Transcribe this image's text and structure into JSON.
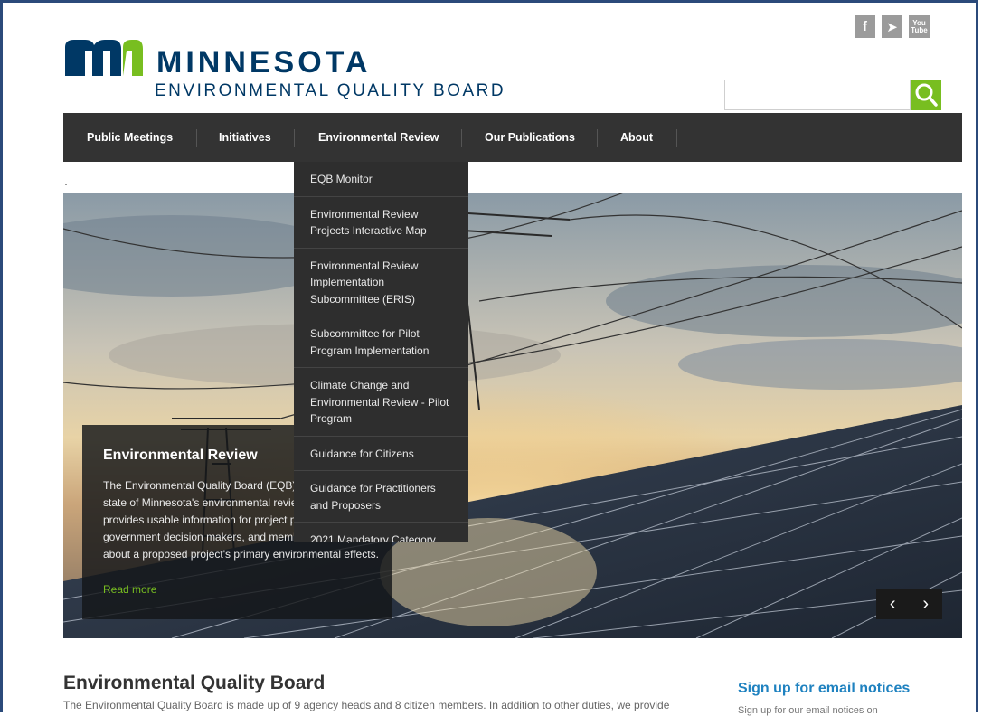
{
  "header": {
    "logo_name": "MINNESOTA",
    "logo_sub": "ENVIRONMENTAL QUALITY BOARD",
    "social": [
      {
        "icon": "facebook-icon",
        "glyph": "f"
      },
      {
        "icon": "twitter-icon",
        "glyph": "➤"
      },
      {
        "icon": "youtube-icon",
        "glyph": "You Tube"
      }
    ],
    "search": {
      "placeholder": "",
      "value": ""
    }
  },
  "nav": {
    "items": [
      "Public Meetings",
      "Initiatives",
      "Environmental Review",
      "Our Publications",
      "About"
    ]
  },
  "dropdown": {
    "items": [
      "EQB Monitor",
      "Environmental Review Projects Interactive Map",
      "Environmental Review Implementation Subcommittee (ERIS)",
      "Subcommittee for Pilot Program Implementation",
      "Climate Change and Environmental Review - Pilot Program",
      "Guidance for Citizens",
      "Guidance for Practitioners and Proposers",
      "2021 Mandatory Category"
    ]
  },
  "hero": {
    "title": "Environmental Review",
    "body": "The Environmental Quality Board (EQB) oversees the state of Minnesota's environmental review program, which provides usable information for project proposers, government decision makers, and members of the public about a proposed project's primary environmental effects.",
    "read_more": "Read more",
    "prev": "‹",
    "next": "›"
  },
  "main": {
    "title": "Environmental Quality Board",
    "intro": "The Environmental Quality Board is made up of 9 agency heads and 8 citizen members. In addition to other duties, we provide"
  },
  "sidebar": {
    "signup_title": "Sign up for email notices",
    "signup_body": "Sign up for our email notices on"
  },
  "colors": {
    "brand": "#003865",
    "accent": "#78be20",
    "nav_bg": "#333333",
    "link": "#1f82c0"
  }
}
